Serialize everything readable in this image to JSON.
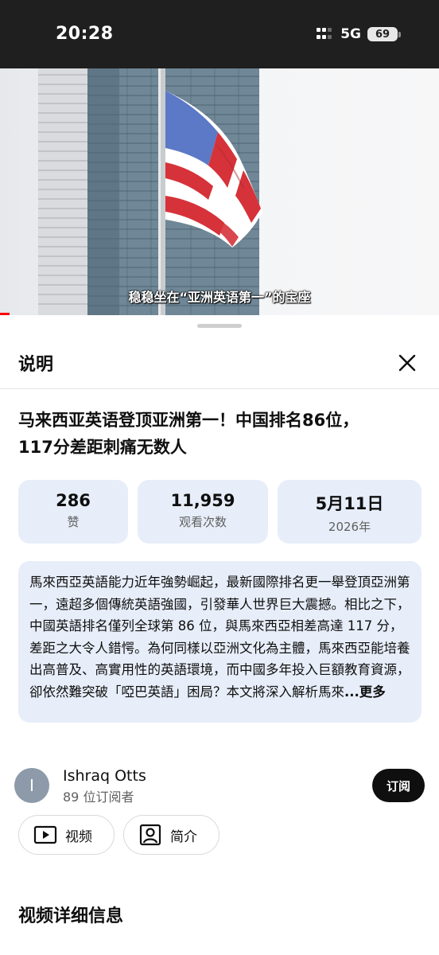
{
  "status_bar": {
    "time": "20:28",
    "network": "5G",
    "battery": "69"
  },
  "video": {
    "caption": "稳稳坐在“亚洲英语第一”的宝座",
    "colors": {
      "progress": "#ff0000",
      "flag_red": "#d6323a",
      "flag_blue": "#5b79c6",
      "building": "#6f8796"
    }
  },
  "sheet": {
    "title": "说明",
    "close_icon": "close-icon",
    "video_title_line1": "马来西亚英语登顶亚洲第一！中国排名86位，",
    "video_title_line2": "117分差距刺痛无数人",
    "stats": {
      "likes_value": "286",
      "likes_label": "赞",
      "views_value": "11,959",
      "views_label": "观看次数",
      "date_value": "5月11日",
      "date_year": "2026年"
    },
    "description": {
      "text": "馬來西亞英語能力近年強勢崛起，最新國際排名更一舉登頂亞洲第一，遠超多個傳統英語強國，引發華人世界巨大震撼。相比之下，中國英語排名僅列全球第 86 位，與馬來西亞相差高達 117 分，差距之大令人錯愕。為何同樣以亞洲文化為主體，馬來西亞能培養出高普及、高實用性的英語環境，而中國多年投入巨額教育資源，卻依然難突破「啞巴英語」困局？本文將深入解析馬來",
      "more": "...更多"
    },
    "channel": {
      "avatar_letter": "I",
      "name": "Ishraq Otts",
      "subscribers": "89 位订阅者",
      "subscribe_label": "订阅"
    },
    "pills": {
      "videos_label": "视频",
      "videos_icon": "play-box-icon",
      "about_label": "简介",
      "about_icon": "profile-icon"
    },
    "details_heading": "视频详细信息"
  }
}
